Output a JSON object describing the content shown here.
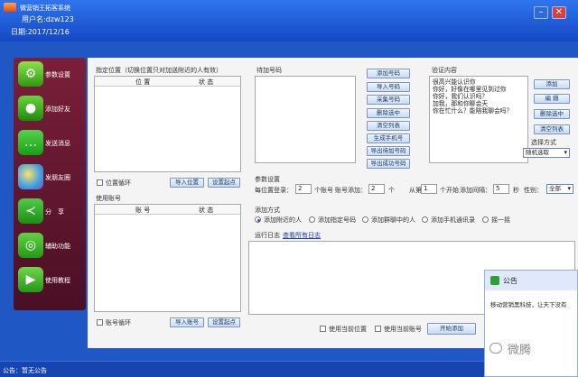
{
  "window": {
    "title": "微营销王拓客系统",
    "user": "用户名:dzw123",
    "date": "日期:2017/12/16",
    "minimize_icon": "minimize-icon",
    "close_icon": "close-icon"
  },
  "sidebar": {
    "items": [
      {
        "label": "参数设置",
        "icon": "gear-icon"
      },
      {
        "label": "添加好友",
        "icon": "wechat-icon"
      },
      {
        "label": "发送消息",
        "icon": "chat-bubble-icon"
      },
      {
        "label": "发朋友圈",
        "icon": "moments-icon"
      },
      {
        "label": "分　享",
        "icon": "share-icon"
      },
      {
        "label": "辅助功能",
        "icon": "assist-icon"
      },
      {
        "label": "使用教程",
        "icon": "play-icon"
      }
    ]
  },
  "location": {
    "title": "指定位置（切换位置只对加送附近的人有效）",
    "col_position": "位 置",
    "col_status": "状 态",
    "loop_label": "位置循环",
    "import_btn": "导入位置",
    "settings_btn": "设置起点"
  },
  "accounts": {
    "title": "使用账号",
    "col_account": "账 号",
    "col_status": "状 态",
    "loop_label": "账号循环",
    "import_btn": "导入账号",
    "settings_btn": "设置起点"
  },
  "pending": {
    "title": "待加号码",
    "buttons": [
      "添加号码",
      "导入号码",
      "采集号码",
      "删除选中",
      "清空列表",
      "生成手机号",
      "导出待加号码",
      "导出成功号码"
    ]
  },
  "verify": {
    "title": "验证内容",
    "lines": [
      "很高兴能认识你",
      "你好，好像在哪里见到过你",
      "你好，我们认识吗？",
      "加我，那和你聊会天",
      "你在忙什么？能陪我聊会吗？"
    ],
    "add_btn": "添加",
    "edit_btn": "编 辑",
    "delete_btn": "删除选中",
    "clear_btn": "清空列表",
    "mode_label": "选择方式",
    "mode_value": "随机选取"
  },
  "params": {
    "title": "参数设置",
    "per_login_label": "每位置登录：",
    "per_login_value": "2",
    "per_login_unit": "个账号",
    "per_add_label": "账号添加：",
    "per_add_value": "2",
    "per_add_unit": "个",
    "from_label": "从第",
    "from_value": "1",
    "from_unit": "个开始",
    "interval_label": "添加间隔：",
    "interval_value": "5",
    "interval_unit": "秒",
    "gender_label": "性别：",
    "gender_value": "全部"
  },
  "method": {
    "title": "添加方式",
    "options": [
      "添加附近的人",
      "添加指定号码",
      "添加群聊中的人",
      "添加手机通讯录",
      "摇一摇"
    ],
    "selected": 0
  },
  "log": {
    "label": "运行日志",
    "view_all": "查看所有日志"
  },
  "bottom": {
    "use_position": "使用当前位置",
    "use_account": "使用当前账号",
    "start_btn": "开始添加"
  },
  "status": {
    "text": "公告：暂无公告"
  },
  "popup": {
    "title": "公告",
    "body": "移动营销黑科技，让天下没有",
    "watermark": "微腾"
  }
}
